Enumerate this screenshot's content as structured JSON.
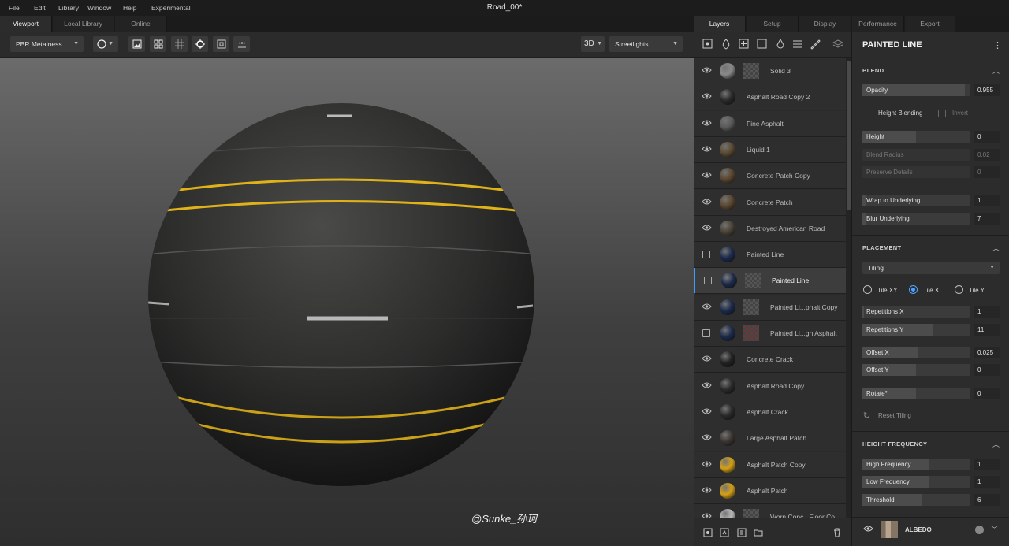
{
  "menu": [
    "File",
    "Edit",
    "Library",
    "Window",
    "Help",
    "Experimental"
  ],
  "document_title": "Road_00*",
  "left_tabs": [
    {
      "label": "Viewport",
      "active": true
    },
    {
      "label": "Local Library",
      "active": false
    },
    {
      "label": "Online",
      "active": false
    }
  ],
  "toolbar": {
    "material_mode": "PBR Metalness",
    "view_mode": "3D",
    "environment": "Streetlights"
  },
  "right_tabs": [
    {
      "label": "Layers",
      "active": true
    },
    {
      "label": "Setup",
      "active": false
    },
    {
      "label": "Display",
      "active": false
    },
    {
      "label": "Performance",
      "active": false
    },
    {
      "label": "Export",
      "active": false
    }
  ],
  "layers": [
    {
      "name": "Solid 3",
      "toggle": "eye",
      "thumb": "#8a8a8a",
      "mask": true,
      "indent": true
    },
    {
      "name": "Asphalt Road Copy 2",
      "toggle": "eye",
      "thumb": "#2a2a2a",
      "mask": false,
      "indent": false
    },
    {
      "name": "Fine Asphalt",
      "toggle": "eye",
      "thumb": "#5a5a5a",
      "mask": false,
      "indent": false
    },
    {
      "name": "Liquid 1",
      "toggle": "eye",
      "thumb": "#5a4a33",
      "mask": false,
      "indent": false
    },
    {
      "name": "Concrete Patch Copy",
      "toggle": "eye",
      "thumb": "#5b4630",
      "mask": false,
      "indent": false
    },
    {
      "name": "Concrete Patch",
      "toggle": "eye",
      "thumb": "#5b4630",
      "mask": false,
      "indent": false
    },
    {
      "name": "Destroyed American Road",
      "toggle": "eye",
      "thumb": "#4a4236",
      "mask": false,
      "indent": false
    },
    {
      "name": "Painted Line",
      "toggle": "check",
      "thumb": "#1c2a4a",
      "mask": false,
      "indent": false
    },
    {
      "name": "Painted Line",
      "toggle": "check",
      "thumb": "#1c2a4a",
      "mask": true,
      "indent": true,
      "selected": true
    },
    {
      "name": "Painted Li...phalt Copy",
      "toggle": "eye",
      "thumb": "#1c2a4a",
      "mask": true,
      "indent": true
    },
    {
      "name": "Painted Li...gh Asphalt",
      "toggle": "check",
      "thumb": "#1c2a4a",
      "mask": true,
      "indent": true,
      "redmask": true
    },
    {
      "name": "Concrete Crack",
      "toggle": "eye",
      "thumb": "#222",
      "mask": false,
      "indent": false
    },
    {
      "name": "Asphalt Road Copy",
      "toggle": "eye",
      "thumb": "#2a2a2a",
      "mask": false,
      "indent": false
    },
    {
      "name": "Asphalt Crack",
      "toggle": "eye",
      "thumb": "#2a2a2a",
      "mask": false,
      "indent": false
    },
    {
      "name": "Large Asphalt Patch",
      "toggle": "eye",
      "thumb": "#3a3530",
      "mask": false,
      "indent": false
    },
    {
      "name": "Asphalt Patch Copy",
      "toggle": "eye",
      "thumb": "#d4a017",
      "mask": false,
      "indent": false
    },
    {
      "name": "Asphalt Patch",
      "toggle": "eye",
      "thumb": "#d4a017",
      "mask": false,
      "indent": false
    },
    {
      "name": "Worn Conc...Floor Co",
      "toggle": "eye",
      "thumb": "#bbbbbb",
      "mask": true,
      "indent": true
    }
  ],
  "props": {
    "title": "PAINTED LINE",
    "blend": {
      "header": "BLEND",
      "opacity_label": "Opacity",
      "opacity_value": "0.955",
      "opacity_fraction": 0.955,
      "height_blending_label": "Height Blending",
      "invert_label": "Invert",
      "height_label": "Height",
      "height_value": "0",
      "height_fraction": 0.5,
      "blend_radius_label": "Blend Radius",
      "blend_radius_value": "0.02",
      "preserve_details_label": "Preserve Details",
      "preserve_details_value": "0",
      "wrap_label": "Wrap to Underlying",
      "wrap_value": "1",
      "blur_label": "Blur Underlying",
      "blur_value": "7"
    },
    "placement": {
      "header": "PLACEMENT",
      "mode": "Tiling",
      "tile_xy": "Tile XY",
      "tile_x": "Tile X",
      "tile_y": "Tile Y",
      "rep_x_label": "Repetitions X",
      "rep_x_value": "1",
      "rep_y_label": "Repetitions Y",
      "rep_y_value": "11",
      "off_x_label": "Offset X",
      "off_x_value": "0.025",
      "off_y_label": "Offset Y",
      "off_y_value": "0",
      "rotate_label": "Rotate°",
      "rotate_value": "0",
      "reset_label": "Reset Tiling"
    },
    "height_frequency": {
      "header": "HEIGHT FREQUENCY",
      "high_label": "High Frequency",
      "high_value": "1",
      "low_label": "Low Frequency",
      "low_value": "1",
      "threshold_label": "Threshold",
      "threshold_value": "6"
    },
    "channel": {
      "label": "ALBEDO"
    }
  },
  "watermark": "@Sunke_孙珂",
  "colors": {
    "accent": "#3aa0ff",
    "lane_yellow": "#e0b21a",
    "asphalt": "#2a2a2a"
  }
}
